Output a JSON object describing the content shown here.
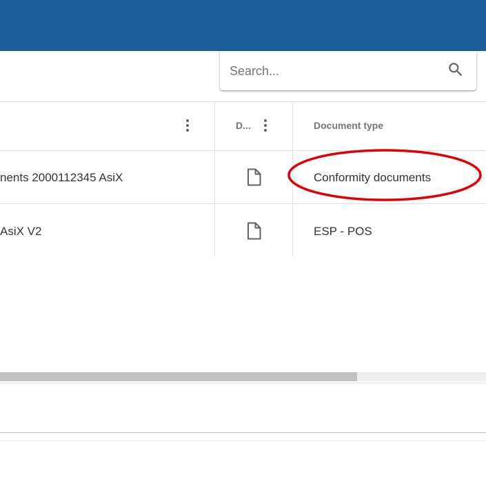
{
  "header": {
    "bar_color": "#1c5d9b"
  },
  "search": {
    "placeholder": "Search...",
    "value": "",
    "icon": "search-icon"
  },
  "table": {
    "columns": [
      {
        "label": ""
      },
      {
        "label": "D..."
      },
      {
        "label": "Document type"
      }
    ],
    "rows": [
      {
        "name": "nents 2000112345 AsiX",
        "icon": "document-icon",
        "type": "Conformity documents"
      },
      {
        "name": "AsiX V2",
        "icon": "document-icon",
        "type": "ESP - POS"
      }
    ]
  },
  "annotation": {
    "shape": "ellipse",
    "color": "#e00000",
    "target": "Conformity documents"
  }
}
